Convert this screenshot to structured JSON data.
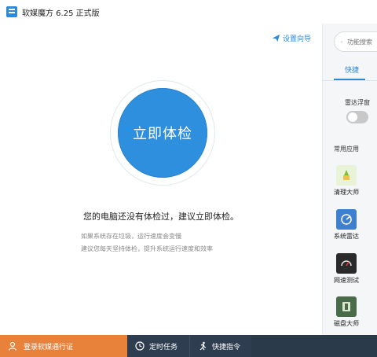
{
  "titlebar": {
    "title": "软媒魔方 6.25 正式版"
  },
  "main": {
    "guide_label": "设置向导",
    "check_button": "立即体检",
    "status": "您的电脑还没有体检过，建议立即体检。",
    "hint1": "如果系统存在垃圾，运行速度会变慢",
    "hint2": "建议您每天坚持体检，提升系统运行速度和效率"
  },
  "sidebar": {
    "search_placeholder": "功能搜索",
    "tab_label": "快捷",
    "radar_label": "雷达浮窗",
    "radar_enabled": false,
    "common_label": "常用应用",
    "tools": [
      {
        "label": "清理大师",
        "icon": "broom-icon"
      },
      {
        "label": "系统雷达",
        "icon": "radar-icon"
      },
      {
        "label": "网速测试",
        "icon": "speedometer-icon"
      },
      {
        "label": "磁盘大师",
        "icon": "disk-icon"
      }
    ]
  },
  "bottombar": {
    "login_label": "登录软媒通行证",
    "timer_label": "定时任务",
    "quick_label": "快捷指令"
  },
  "colors": {
    "accent": "#2e8fde",
    "login_bg": "#e8823a",
    "bar_bg": "#2b3a4a"
  }
}
